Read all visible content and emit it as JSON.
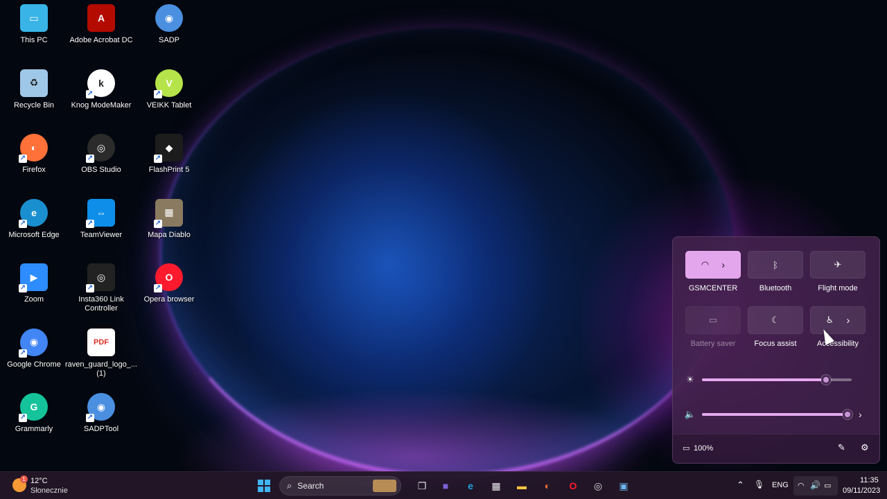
{
  "desktop": {
    "icons": [
      {
        "label": "This PC",
        "icon": "monitor-icon",
        "color": "#39b4e6"
      },
      {
        "label": "Adobe Acrobat DC",
        "icon": "acrobat-icon",
        "color": "#b30b00"
      },
      {
        "label": "SADP",
        "icon": "sadp-icon",
        "color": "#4a8fe0"
      },
      {
        "label": "Recycle Bin",
        "icon": "recycle-bin-icon",
        "color": "#9fc7e8"
      },
      {
        "label": "Knog ModeMaker",
        "icon": "knog-icon",
        "color": "#ffffff"
      },
      {
        "label": "VEIKK Tablet",
        "icon": "veikk-icon",
        "color": "#b5e34a"
      },
      {
        "label": "Firefox",
        "icon": "firefox-icon",
        "color": "#ff7139"
      },
      {
        "label": "OBS Studio",
        "icon": "obs-icon",
        "color": "#2b2b2b"
      },
      {
        "label": "FlashPrint 5",
        "icon": "flashprint-icon",
        "color": "#1c1c1c"
      },
      {
        "label": "Microsoft Edge",
        "icon": "edge-icon",
        "color": "#1a8fd0"
      },
      {
        "label": "TeamViewer",
        "icon": "teamviewer-icon",
        "color": "#0e8ee9"
      },
      {
        "label": "Mapa Diablo",
        "icon": "map-image-icon",
        "color": "#8a7a60"
      },
      {
        "label": "Zoom",
        "icon": "zoom-icon",
        "color": "#2d8cff"
      },
      {
        "label": "Insta360 Link Controller",
        "icon": "insta360-icon",
        "color": "#222222"
      },
      {
        "label": "Opera browser",
        "icon": "opera-icon",
        "color": "#ff1b2d"
      },
      {
        "label": "Google Chrome",
        "icon": "chrome-icon",
        "color": "#4285f4"
      },
      {
        "label": "raven_guard_logo_... (1)",
        "icon": "pdf-file-icon",
        "color": "#d93025"
      },
      {
        "label": "Grammarly",
        "icon": "grammarly-icon",
        "color": "#15c39a"
      },
      {
        "label": "SADPTool",
        "icon": "sadp-icon",
        "color": "#4a8fe0"
      }
    ]
  },
  "quick_settings": {
    "tiles": [
      {
        "label": "GSMCENTER",
        "icon": "wifi-icon",
        "active": true,
        "has_arrow": true,
        "disabled": false
      },
      {
        "label": "Bluetooth",
        "icon": "bluetooth-icon",
        "active": false,
        "has_arrow": false,
        "disabled": false
      },
      {
        "label": "Flight mode",
        "icon": "airplane-icon",
        "active": false,
        "has_arrow": false,
        "disabled": false
      },
      {
        "label": "Battery saver",
        "icon": "battery-saver-icon",
        "active": false,
        "has_arrow": false,
        "disabled": true
      },
      {
        "label": "Focus assist",
        "icon": "moon-icon",
        "active": false,
        "has_arrow": false,
        "disabled": false
      },
      {
        "label": "Accessibility",
        "icon": "accessibility-icon",
        "active": false,
        "has_arrow": true,
        "disabled": false
      }
    ],
    "brightness": {
      "icon": "brightness-icon",
      "level": 0.83
    },
    "volume": {
      "icon": "speaker-icon",
      "level": 1.0
    },
    "battery_text": "100%",
    "accent_color": "#e3a6ec"
  },
  "taskbar": {
    "weather": {
      "temp": "12°C",
      "condition": "Słonecznie",
      "badge": "1"
    },
    "search_placeholder": "Search",
    "apps": [
      "windows-start-icon",
      "file-explorer-thumb-icon",
      "task-view-icon",
      "teams-chat-icon",
      "edge-icon",
      "store-icon",
      "folder-icon",
      "firefox-icon",
      "opera-icon",
      "obs-icon",
      "remote-desktop-icon"
    ],
    "tray": {
      "language": "ENG",
      "time": "11:35",
      "date": "09/11/2023"
    }
  }
}
